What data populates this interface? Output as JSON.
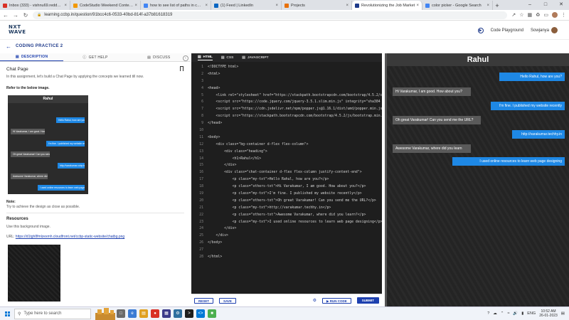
{
  "browser": {
    "tabs": [
      {
        "label": "Inbox (333) - vishnu69.reddy@g...",
        "color": "#d93025",
        "active": false
      },
      {
        "label": "CodeStudio Weekend Contest 5...",
        "color": "#f29900",
        "active": false
      },
      {
        "label": "how to see list of paths in cmd...",
        "color": "#4285f4",
        "active": false
      },
      {
        "label": "(1) Feed | LinkedIn",
        "color": "#0a66c2",
        "active": false
      },
      {
        "label": "Projects",
        "color": "#e8710a",
        "active": false
      },
      {
        "label": "Revolutionizing the Job Market",
        "color": "#1e3a8a",
        "active": true
      },
      {
        "label": "color picker - Google Search",
        "color": "#4285f4",
        "active": false
      }
    ],
    "new_tab": "+",
    "url": "learning.ccbp.in/question/91bcc4c6-0533-40bd-814f-a37b81618319"
  },
  "app": {
    "logo_line1": "NXT",
    "logo_line2": "WAVE",
    "code_playground": "Code Playground",
    "username": "Sowjanya",
    "breadcrumb": "CODING PRACTICE 2"
  },
  "left_panel": {
    "tabs": {
      "description": "DESCRIPTION",
      "get_help": "GET HELP",
      "discuss": "DISCUSS"
    },
    "title": "Chat Page",
    "intro": "In this assignment, let's build a Chat Page by applying the concepts we learned till now.",
    "refer_heading": "Refer to the below image.",
    "ref_image": {
      "header": "Rahul",
      "messages": [
        {
          "text": "Hello Rahul, how are you?",
          "type": "my"
        },
        {
          "text": "Hi Varakumar, I am good. How about you?",
          "type": "other"
        },
        {
          "text": "I'm fine. I published my website recently",
          "type": "my"
        },
        {
          "text": "Oh great Varakumar! Can you send me the URL?",
          "type": "other"
        },
        {
          "text": "http://varakumar.ccbp.tech",
          "type": "my"
        },
        {
          "text": "Awesome Varakumar, where did you learn?",
          "type": "other"
        },
        {
          "text": "I used online resources to learn web page designing",
          "type": "my"
        }
      ]
    },
    "note_label": "Note:",
    "note_text": "Try to achieve the design as close as possible.",
    "resources_heading": "Resources",
    "resources_text": "Use this background image.",
    "url_label": "URL:",
    "url_link": "https://d1tgh8fmlzexmh.cloudfront.net/ccbp-static-website/chatbg.png"
  },
  "editor": {
    "tabs": {
      "html": "HTML",
      "css": "CSS",
      "js": "JAVASCRIPT"
    },
    "lines": [
      {
        "n": "1",
        "t": "<!DOCTYPE html>"
      },
      {
        "n": "2",
        "t": "<html>"
      },
      {
        "n": "3",
        "t": ""
      },
      {
        "n": "4",
        "t": "<head>"
      },
      {
        "n": "5",
        "t": "    <link rel=\"stylesheet\" href=\"https://stackpath.bootstrapcdn.com/bootstrap/4.5.2/cs"
      },
      {
        "n": "6",
        "t": "    <script src=\"https://code.jquery.com/jquery-3.5.1.slim.min.js\" integrity=\"sha384"
      },
      {
        "n": "7",
        "t": "    <script src=\"https://cdn.jsdelivr.net/npm/popper.js@1.16.1/dist/umd/popper.min.js"
      },
      {
        "n": "8",
        "t": "    <script src=\"https://stackpath.bootstrapcdn.com/bootstrap/4.5.2/js/bootstrap.min."
      },
      {
        "n": "9",
        "t": "</head>"
      },
      {
        "n": "10",
        "t": ""
      },
      {
        "n": "11",
        "t": "<body>"
      },
      {
        "n": "12",
        "t": "    <div class=\"bg-container d-flex flex-column\">"
      },
      {
        "n": "13",
        "t": "        <div class=\"heading\">"
      },
      {
        "n": "14",
        "t": "            <h1>Rahul</h1>"
      },
      {
        "n": "15",
        "t": "        </div>"
      },
      {
        "n": "16",
        "t": "        <div class=\"chat-container d-flex flex-column justify-content-end\">"
      },
      {
        "n": "17",
        "t": "            <p class=\"my-txt\">Hello Rahul, how are you?</p>"
      },
      {
        "n": "18",
        "t": "            <p class=\"others-txt\">Hi Varakumar, I am good. How about you?</p>"
      },
      {
        "n": "19",
        "t": "            <p class=\"my-txt\">I'm fine. I published my website recently</p>"
      },
      {
        "n": "20",
        "t": "            <p class=\"others-txt\">Oh great Varakumar! Can you send me the URL?</p>"
      },
      {
        "n": "21",
        "t": "            <p class=\"my-txt\">http://varakumar.techhy.in</p>"
      },
      {
        "n": "22",
        "t": "            <p class=\"others-txt\">Awesome Varakumar, where did you learn?</p>"
      },
      {
        "n": "23",
        "t": "            <p class=\"my-txt\">I used online resources to learn web page designing</p>"
      },
      {
        "n": "24",
        "t": "        </div>"
      },
      {
        "n": "25",
        "t": "    </div>"
      },
      {
        "n": "26",
        "t": "</body>"
      },
      {
        "n": "27",
        "t": ""
      },
      {
        "n": "28",
        "t": "</html>"
      }
    ],
    "reset": "RESET",
    "save": "SAVE",
    "run_code": "RUN CODE",
    "submit": "SUBMIT"
  },
  "output": {
    "header": "Rahul",
    "messages": [
      {
        "text": "Hello Rahul, how are you?",
        "type": "my"
      },
      {
        "text": "Hi Varakumar, I am good. How about you?",
        "type": "other"
      },
      {
        "text": "I'm fine. I published my website recently",
        "type": "my"
      },
      {
        "text": "Oh great Varakumar! Can you send me the URL?",
        "type": "other"
      },
      {
        "text": "http://varakumar.techhy.in",
        "type": "my"
      },
      {
        "text": "Awesome Varakumar, where did you learn",
        "type": "other"
      },
      {
        "text": "I used online resources to learn web page designing",
        "type": "my"
      }
    ]
  },
  "taskbar": {
    "search_placeholder": "Type here to search",
    "lang": "ENG",
    "time": "10:52 AM",
    "date": "26-01-2023",
    "colors": {
      "win": "#0078d7"
    }
  }
}
